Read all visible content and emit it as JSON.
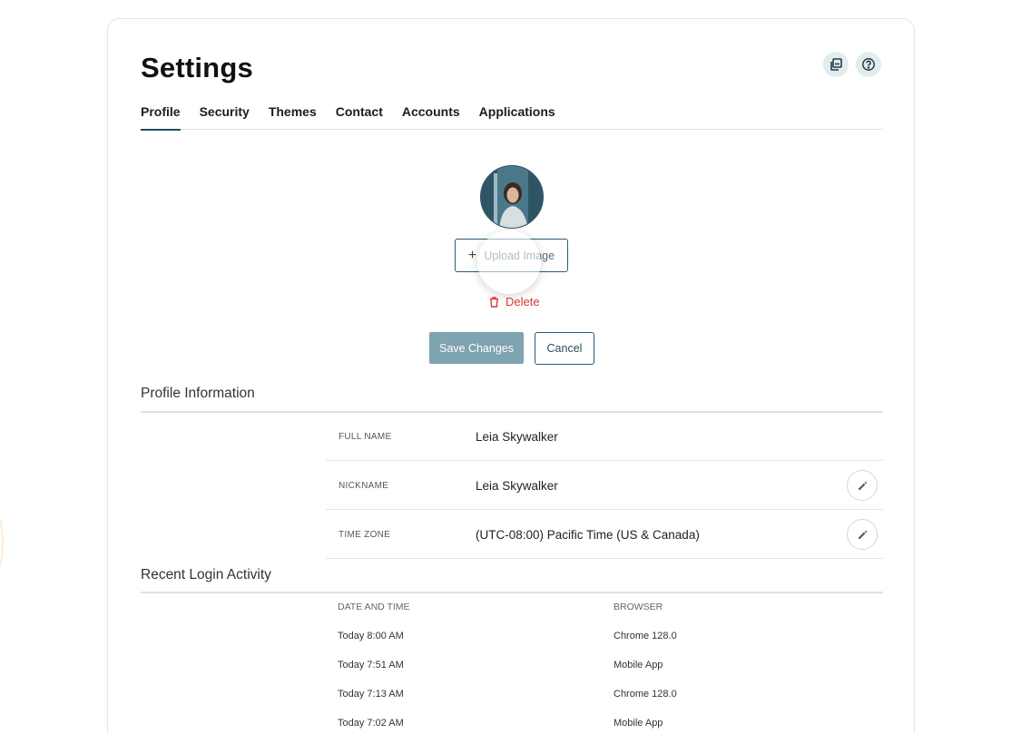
{
  "title": "Settings",
  "tabs": [
    {
      "label": "Profile",
      "active": true
    },
    {
      "label": "Security",
      "active": false
    },
    {
      "label": "Themes",
      "active": false
    },
    {
      "label": "Contact",
      "active": false
    },
    {
      "label": "Accounts",
      "active": false
    },
    {
      "label": "Applications",
      "active": false
    }
  ],
  "header_icons": [
    "copy-icon",
    "help-icon"
  ],
  "avatar": {
    "alt": "profile-avatar"
  },
  "upload_button": {
    "icon": "plus-icon",
    "label": "Upload Image"
  },
  "delete_link": {
    "icon": "trash-icon",
    "label": "Delete"
  },
  "actions": {
    "save_label": "Save Changes",
    "cancel_label": "Cancel"
  },
  "profile_section": {
    "title": "Profile Information",
    "rows": [
      {
        "label": "FULL NAME",
        "value": "Leia Skywalker",
        "editable": false
      },
      {
        "label": "NICKNAME",
        "value": "Leia Skywalker",
        "editable": true
      },
      {
        "label": "TIME ZONE",
        "value": "(UTC-08:00) Pacific Time (US & Canada)",
        "editable": true
      }
    ]
  },
  "login_section": {
    "title": "Recent Login Activity",
    "headers": [
      "DATE AND TIME",
      "BROWSER"
    ],
    "rows": [
      [
        "Today 8:00 AM",
        "Chrome 128.0"
      ],
      [
        "Today 7:51 AM",
        "Mobile App"
      ],
      [
        "Today 7:13 AM",
        "Chrome 128.0"
      ],
      [
        "Today 7:02 AM",
        "Mobile App"
      ]
    ]
  },
  "colors": {
    "accent": "#1e4f66",
    "save_button": "#7ea3b1",
    "danger": "#d9383a"
  }
}
